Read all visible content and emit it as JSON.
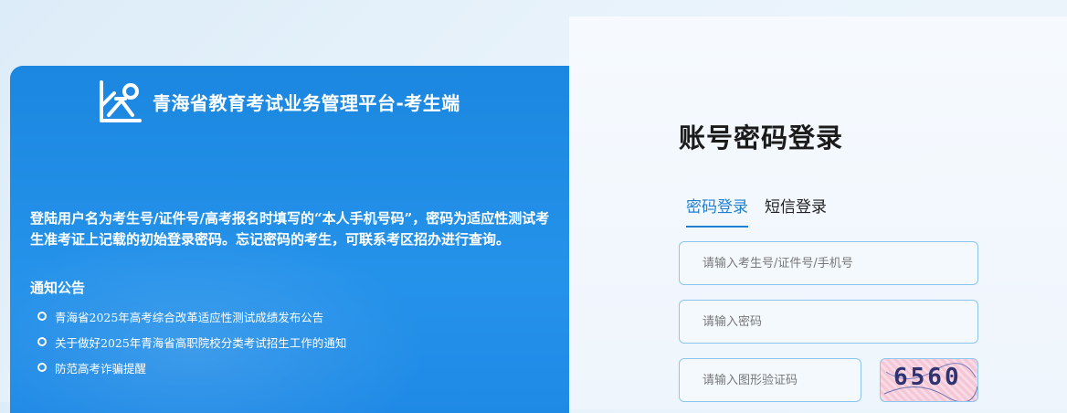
{
  "platform": {
    "title": "青海省教育考试业务管理平台-考生端",
    "notice": "登陆用户名为考生号/证件号/高考报名时填写的“本人手机号码”，密码为适应性测试考生准考证上记载的初始登录密码。忘记密码的考生，可联系考区招办进行查询。",
    "announcement_title": "通知公告",
    "announcements": [
      "青海省2025年高考综合改革适应性测试成绩发布公告",
      "关于做好2025年青海省高职院校分类考试招生工作的通知",
      "防范高考诈骗提醒"
    ]
  },
  "login": {
    "title": "账号密码登录",
    "tabs": [
      "密码登录",
      "短信登录"
    ],
    "active_tab": 0,
    "username_placeholder": "请输入考生号/证件号/手机号",
    "password_placeholder": "请输入密码",
    "captcha_placeholder": "请输入图形验证码",
    "captcha_text": "6560"
  },
  "colors": {
    "panel_blue": "#1b87e0",
    "accent": "#1f7fd0",
    "input_border": "#8cc6ee"
  },
  "icons": {
    "logo": "exam-logo-icon"
  }
}
